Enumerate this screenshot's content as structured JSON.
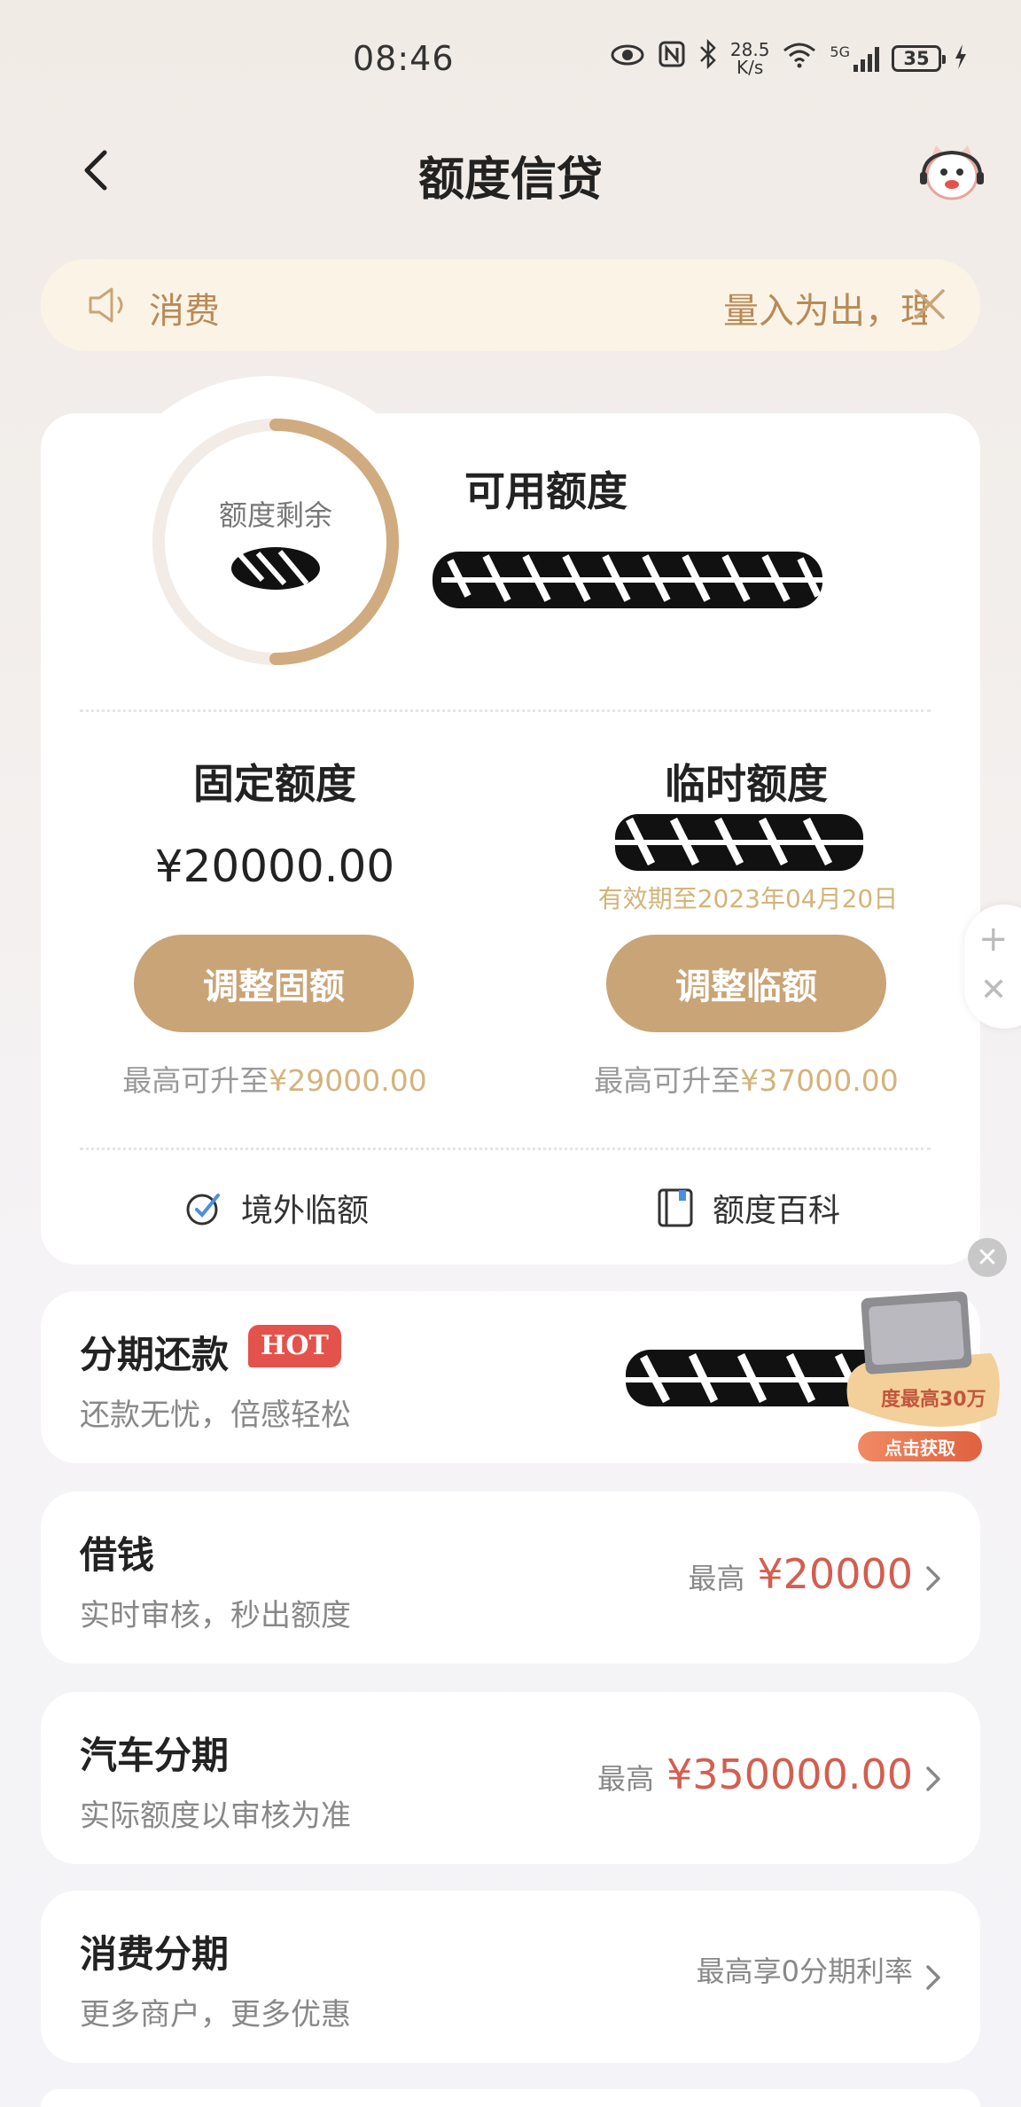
{
  "status_bar": {
    "time": "08:46",
    "net_speed_value": "28.5",
    "net_speed_unit": "K/s",
    "signal_label": "5G",
    "battery": "35"
  },
  "header": {
    "title": "额度信贷"
  },
  "notice": {
    "label": "消费",
    "scroll_text": "量入为出，理性消费"
  },
  "credit": {
    "ring_label": "额度剩余",
    "available_label": "可用额度",
    "fixed": {
      "title": "固定额度",
      "amount": "¥20000.00",
      "button": "调整固额",
      "max_prefix": "最高可升至",
      "max_amount": "¥29000.00"
    },
    "temporary": {
      "title": "临时额度",
      "valid_until": "有效期至2023年04月20日",
      "button": "调整临额",
      "max_prefix": "最高可升至",
      "max_amount": "¥37000.00"
    },
    "links": [
      {
        "label": "境外临额",
        "icon": "plane-globe-icon"
      },
      {
        "label": "额度百科",
        "icon": "book-icon"
      }
    ]
  },
  "installment_repay": {
    "title": "分期还款",
    "badge": "HOT",
    "subtitle": "还款无忧，倍感轻松"
  },
  "promo": {
    "text": "度最高30万",
    "button": "点击获取"
  },
  "services": [
    {
      "title": "借钱",
      "subtitle": "实时审核，秒出额度",
      "prefix": "最高",
      "amount": "¥20000"
    },
    {
      "title": "汽车分期",
      "subtitle": "实际额度以审核为准",
      "prefix": "最高",
      "amount": "¥350000.00"
    },
    {
      "title": "消费分期",
      "subtitle": "更多商户，更多优惠",
      "prefix": "最高享0分期利率",
      "amount": ""
    }
  ],
  "colors": {
    "accent_gold": "#c9a477",
    "accent_gold_light": "#d4b37a",
    "amount_red": "#d35e4f",
    "hot_red": "#e3524b"
  }
}
